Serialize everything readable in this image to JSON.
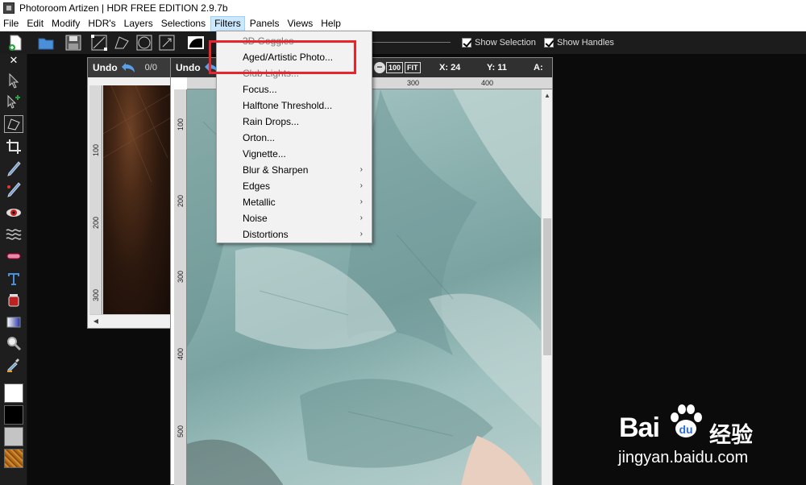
{
  "window": {
    "title": "Photoroom Artizen | HDR FREE EDITION 2.9.7b"
  },
  "menubar": {
    "items": [
      "File",
      "Edit",
      "Modify",
      "HDR's",
      "Layers",
      "Selections",
      "Filters",
      "Panels",
      "Views",
      "Help"
    ],
    "active_index": 6
  },
  "toolbar": {
    "show_selection": "Show Selection",
    "show_handles": "Show Handles",
    "close_symbol": "✕"
  },
  "doc1": {
    "undo_label": "Undo",
    "undo_count": "0/0",
    "ruler_labels": [
      "100",
      "200",
      "300"
    ]
  },
  "doc2": {
    "undo_label": "Undo",
    "zoom_100": "100",
    "fit": "FIT",
    "x_label": "X:",
    "x_value": "24",
    "y_label": "Y:",
    "y_value": "11",
    "a_label": "A:",
    "hruler_labels": [
      "300",
      "400"
    ],
    "vruler_labels": [
      "100",
      "200",
      "300",
      "400",
      "500"
    ]
  },
  "filters_menu": {
    "items": [
      {
        "label": "3D Goggles",
        "submenu": false
      },
      {
        "label": "Aged/Artistic Photo...",
        "submenu": false
      },
      {
        "label": "Club Lights...",
        "submenu": false
      },
      {
        "label": "Focus...",
        "submenu": false
      },
      {
        "label": "Halftone Threshold...",
        "submenu": false
      },
      {
        "label": "Rain Drops...",
        "submenu": false
      },
      {
        "label": "Orton...",
        "submenu": false
      },
      {
        "label": "Vignette...",
        "submenu": false
      },
      {
        "label": "Blur & Sharpen",
        "submenu": true
      },
      {
        "label": "Edges",
        "submenu": true
      },
      {
        "label": "Metallic",
        "submenu": true
      },
      {
        "label": "Noise",
        "submenu": true
      },
      {
        "label": "Distortions",
        "submenu": true
      }
    ],
    "submenu_arrow": "›"
  },
  "colors": {
    "highlight_box": "#e8252b",
    "menu_active_bg": "#cce8ff",
    "toolbar_bg": "#1c1c1c",
    "workspace_bg": "#0b0b0b"
  },
  "watermark": {
    "brand_left": "Bai",
    "brand_right": "经验",
    "url": "jingyan.baidu.com"
  }
}
